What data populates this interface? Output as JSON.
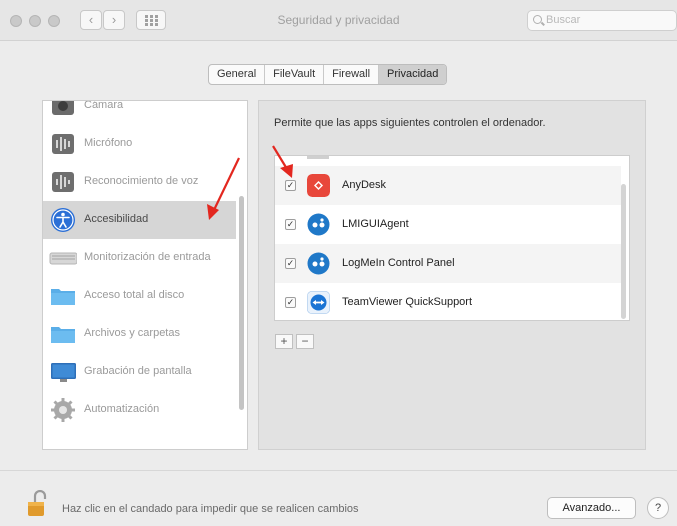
{
  "window": {
    "title": "Seguridad y privacidad",
    "search_placeholder": "Buscar",
    "back_glyph": "‹",
    "forward_glyph": "›"
  },
  "tabs": [
    {
      "label": "General",
      "selected": false
    },
    {
      "label": "FileVault",
      "selected": false
    },
    {
      "label": "Firewall",
      "selected": false
    },
    {
      "label": "Privacidad",
      "selected": true
    }
  ],
  "sidebar": {
    "items": [
      {
        "label": "Cámara",
        "icon": "camera-icon",
        "selected": false
      },
      {
        "label": "Micrófono",
        "icon": "microphone-icon",
        "selected": false
      },
      {
        "label": "Reconocimiento de voz",
        "icon": "speech-recognition-icon",
        "selected": false
      },
      {
        "label": "Accesibilidad",
        "icon": "accessibility-icon",
        "selected": true
      },
      {
        "label": "Monitorización de entrada",
        "icon": "keyboard-icon",
        "selected": false
      },
      {
        "label": "Acceso total al disco",
        "icon": "folder-icon",
        "selected": false
      },
      {
        "label": "Archivos y carpetas",
        "icon": "folder-icon",
        "selected": false
      },
      {
        "label": "Grabación de pantalla",
        "icon": "display-icon",
        "selected": false
      },
      {
        "label": "Automatización",
        "icon": "gear-icon",
        "selected": false
      }
    ]
  },
  "panel": {
    "description": "Permite que las apps siguientes controlen el ordenador.",
    "apps": [
      {
        "name": "AnyDesk",
        "checked": true,
        "icon": "anydesk-icon",
        "color": "#e8473b"
      },
      {
        "name": "LMIGUIAgent",
        "checked": true,
        "icon": "logmein-icon",
        "color": "#1f78c8"
      },
      {
        "name": "LogMeIn Control Panel",
        "checked": true,
        "icon": "logmein-icon",
        "color": "#1f78c8"
      },
      {
        "name": "TeamViewer QuickSupport",
        "checked": true,
        "icon": "teamviewer-icon",
        "color": "#1a74d4"
      }
    ],
    "add_label": "+",
    "remove_label": "−"
  },
  "footer": {
    "lock_text": "Haz clic en el candado para impedir que se realicen cambios",
    "advanced_label": "Avanzado...",
    "help_label": "?"
  },
  "colors": {
    "selection": "#d6d6d6",
    "annotation_arrow": "#e3271f"
  }
}
